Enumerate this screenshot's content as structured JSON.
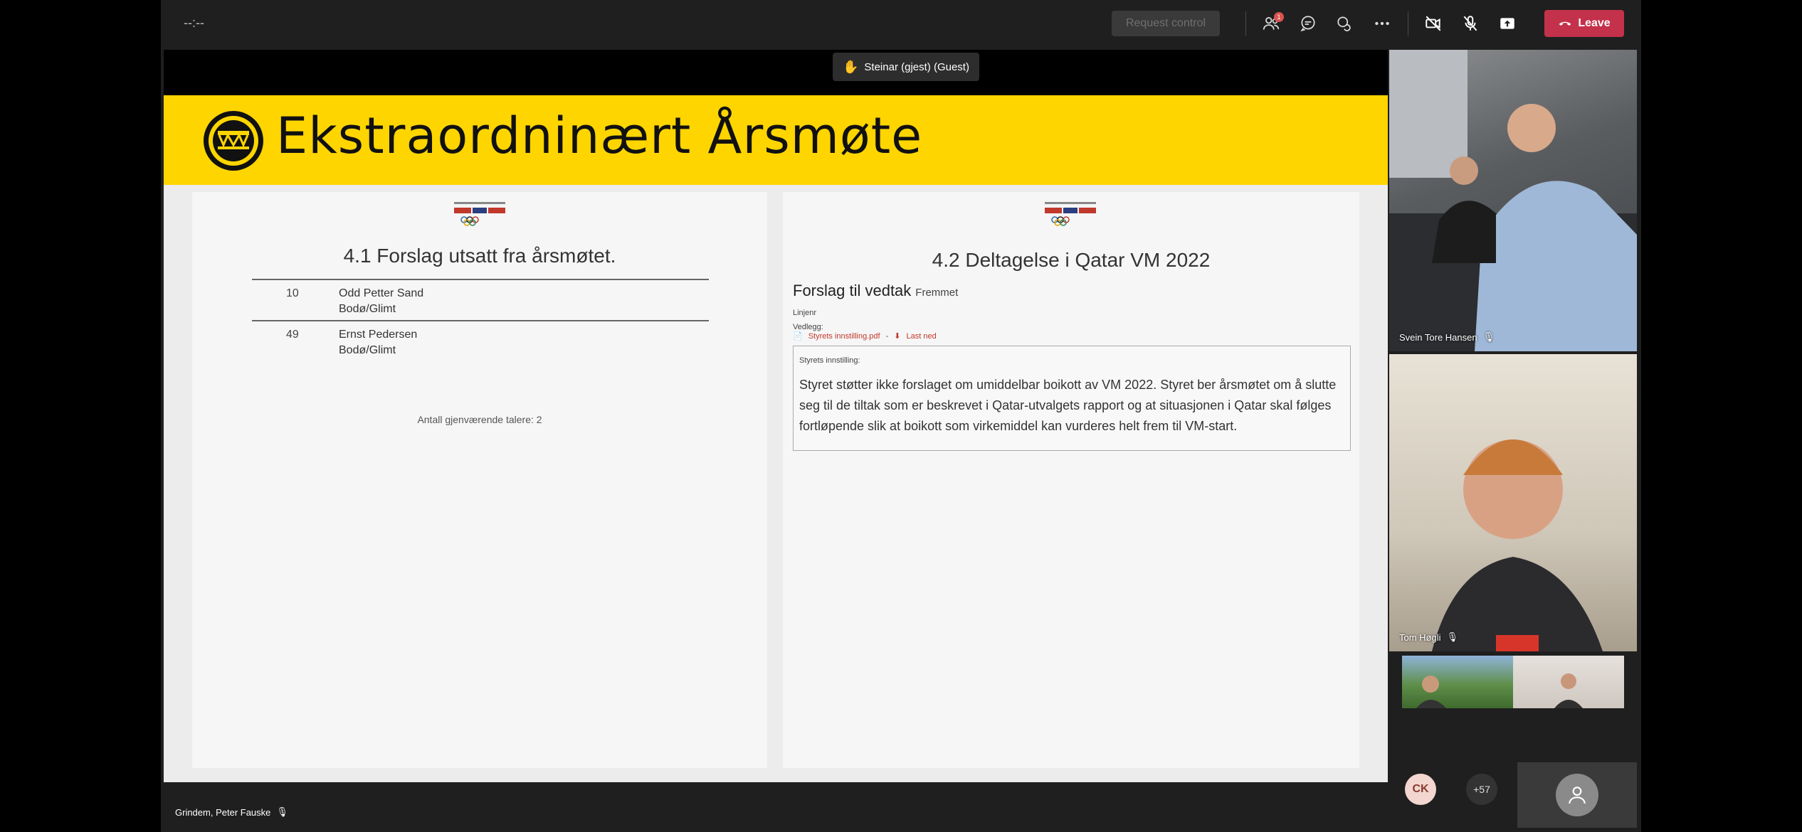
{
  "toolbar": {
    "timer": "--:--",
    "request_control": "Request control",
    "participants_badge": "1",
    "leave_label": "Leave"
  },
  "stage": {
    "hand_raised_name": "Steinar (gjest) (Guest)",
    "slide": {
      "banner_title": "Ekstraordninært Årsmøte",
      "left_panel": {
        "title": "4.1 Forslag utsatt fra årsmøtet.",
        "rows": [
          {
            "number": "10",
            "name": "Odd Petter Sand",
            "club": "Bodø/Glimt"
          },
          {
            "number": "49",
            "name": "Ernst Pedersen",
            "club": "Bodø/Glimt"
          }
        ],
        "remaining": "Antall gjenværende talere: 2"
      },
      "right_panel": {
        "title": "4.2 Deltagelse i Qatar VM 2022",
        "proposal_heading": "Forslag til vedtak",
        "proposal_status": "Fremmet",
        "linjenr_label": "Linjenr",
        "vedlegg_label": "Vedlegg:",
        "attachment_name": "Styrets innstilling.pdf",
        "attachment_sep": "-",
        "download_label": "Last ned",
        "recommendation_label": "Styrets innstilling:",
        "recommendation_text": "Styret støtter ikke forslaget om umiddelbar boikott av VM 2022. Styret ber årsmøtet om å slutte seg til de tiltak som er beskrevet i Qatar-utvalgets rapport og at situasjonen i Qatar skal følges fortløpende slik at boikott som virkemiddel kan vurderes helt frem til VM-start."
      }
    }
  },
  "participants": {
    "video1_name": "Svein Tore Hansen",
    "video2_name": "Tom Høgli",
    "ck_initials": "CK",
    "more_count": "+57",
    "bottom_name": "Grindem, Peter Fauske"
  },
  "colors": {
    "banner": "#ffd500",
    "leave": "#c4314b",
    "attachment": "#c0392b"
  }
}
